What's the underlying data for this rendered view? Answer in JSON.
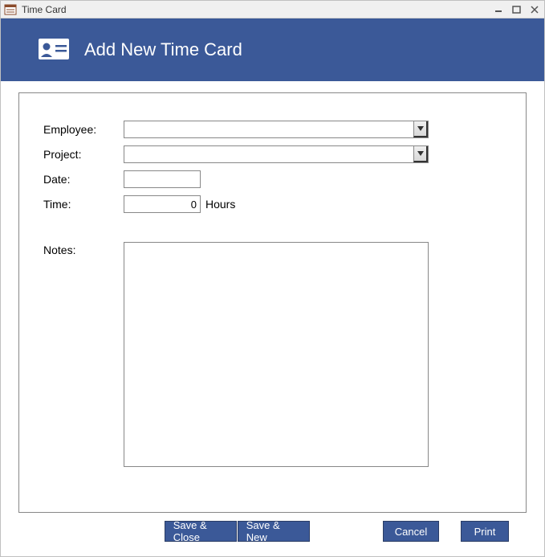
{
  "window": {
    "title": "Time Card"
  },
  "header": {
    "title": "Add New Time Card"
  },
  "form": {
    "employee": {
      "label": "Employee:",
      "value": ""
    },
    "project": {
      "label": "Project:",
      "value": ""
    },
    "date": {
      "label": "Date:",
      "value": ""
    },
    "time": {
      "label": "Time:",
      "value": "0",
      "suffix": "Hours"
    },
    "notes": {
      "label": "Notes:",
      "value": ""
    }
  },
  "buttons": {
    "save_close": "Save & Close",
    "save_new": "Save & New",
    "cancel": "Cancel",
    "print": "Print"
  }
}
